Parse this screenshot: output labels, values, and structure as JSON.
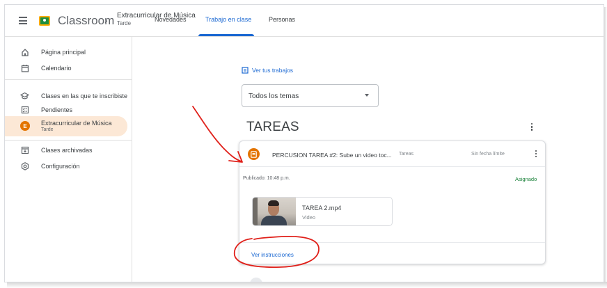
{
  "header": {
    "brand": "Classroom",
    "breadcrumb_chevron": "›",
    "class_title": "Extracurricular de Música",
    "class_subtitle": "Tarde"
  },
  "sidebar": {
    "items": [
      {
        "label": "Página principal",
        "icon": "home-icon"
      },
      {
        "label": "Calendario",
        "icon": "calendar-icon"
      },
      {
        "label": "Clases en las que te inscribiste",
        "icon": "enrolled-icon"
      },
      {
        "label": "Pendientes",
        "icon": "todo-icon"
      },
      {
        "label": "Extracurricular de Música",
        "sub": "Tarde",
        "avatar_letter": "E",
        "active": true
      },
      {
        "label": "Clases archivadas",
        "icon": "archive-icon"
      },
      {
        "label": "Configuración",
        "icon": "settings-icon"
      }
    ]
  },
  "tabs": [
    {
      "label": "Novedades"
    },
    {
      "label": "Trabajo en clase",
      "active": true
    },
    {
      "label": "Personas"
    }
  ],
  "main": {
    "view_work_label": "Ver tus trabajos",
    "topic_filter": "Todos los temas",
    "section_title": "TAREAS"
  },
  "assignment": {
    "title": "PERCUSION TAREA #2: Sube un video toc...",
    "topic": "Tareas",
    "due": "Sin fecha límite",
    "posted": "Publicado: 10:48 p.m.",
    "status": "Asignado",
    "attachment": {
      "name": "TAREA 2.mp4",
      "type": "Video"
    },
    "view_instructions": "Ver instrucciones"
  },
  "colors": {
    "accent_blue": "#1967d2",
    "class_orange": "#e37400",
    "active_bg": "#fce8d6",
    "status_green": "#188038",
    "annotation_red": "#e0201a"
  }
}
